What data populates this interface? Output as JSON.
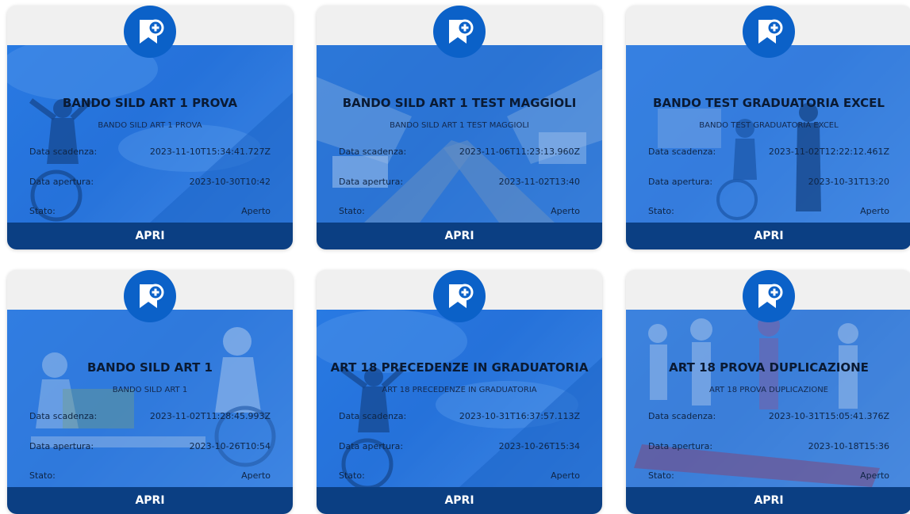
{
  "labels": {
    "deadline": "Data scadenza:",
    "opening": "Data apertura:",
    "status": "Stato:",
    "open_button": "APRI"
  },
  "icon": "bookmark-plus-icon",
  "colors": {
    "badge": "#0b61c8",
    "button": "#0b3f83",
    "photo_tint": "#2a73da"
  },
  "cards": [
    {
      "title": "BANDO SILD ART 1 PROVA",
      "subtitle": "BANDO SILD ART 1 PROVA",
      "deadline": "2023-11-10T15:34:41.727Z",
      "opening": "2023-10-30T10:42",
      "status": "Aperto"
    },
    {
      "title": "BANDO SILD ART 1 TEST MAGGIOLI",
      "subtitle": "BANDO SILD ART 1 TEST MAGGIOLI",
      "deadline": "2023-11-06T11:23:13.960Z",
      "opening": "2023-11-02T13:40",
      "status": "Aperto"
    },
    {
      "title": "BANDO TEST GRADUATORIA EXCEL",
      "subtitle": "BANDO TEST GRADUATORIA EXCEL",
      "deadline": "2023-11-02T12:22:12.461Z",
      "opening": "2023-10-31T13:20",
      "status": "Aperto"
    },
    {
      "title": "BANDO SILD ART 1",
      "subtitle": "BANDO SILD ART 1",
      "deadline": "2023-11-02T11:28:45.993Z",
      "opening": "2023-10-26T10:54",
      "status": "Aperto"
    },
    {
      "title": "ART 18 PRECEDENZE IN GRADUATORIA",
      "subtitle": "ART 18 PRECEDENZE IN GRADUATORIA",
      "deadline": "2023-10-31T16:37:57.113Z",
      "opening": "2023-10-26T15:34",
      "status": "Aperto"
    },
    {
      "title": "ART 18 PROVA DUPLICAZIONE",
      "subtitle": "ART 18 PROVA DUPLICAZIONE",
      "deadline": "2023-10-31T15:05:41.376Z",
      "opening": "2023-10-18T15:36",
      "status": "Aperto"
    }
  ]
}
